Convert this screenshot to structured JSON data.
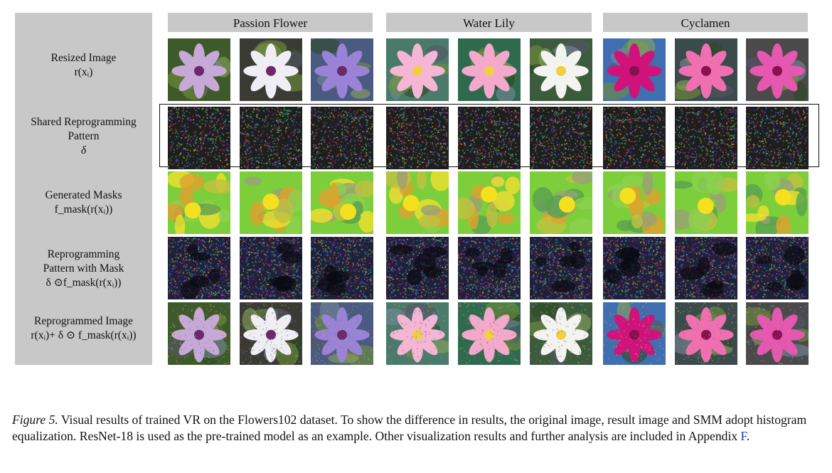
{
  "columns": [
    {
      "label": "Passion Flower"
    },
    {
      "label": "Water Lily"
    },
    {
      "label": "Cyclamen"
    }
  ],
  "rows": [
    {
      "lines": [
        "Resized Image",
        "r(xᵢ)"
      ]
    },
    {
      "lines": [
        "Shared Reprogramming",
        "Pattern",
        "δ"
      ]
    },
    {
      "lines": [
        "Generated Masks",
        "f_mask(r(xᵢ))"
      ]
    },
    {
      "lines": [
        "Reprogramming",
        "Pattern with Mask",
        "δ ⊙f_mask(r(xᵢ))"
      ]
    },
    {
      "lines": [
        "Reprogrammed Image",
        "r(xᵢ)+ δ ⊙ f_mask(r(xᵢ))"
      ]
    }
  ],
  "caption": {
    "label": "Figure 5.",
    "text": " Visual results of trained VR on the Flowers102 dataset. To show the difference in results, the original image, result image and SMM adopt histogram equalization. ResNet-18 is used as the pre-trained model as an example. Other visualization results and further analysis are included in Appendix ",
    "ref": "F",
    "end": "."
  },
  "colors": {
    "panel": "#c8c8c8",
    "ref_link": "#1f3aa5"
  }
}
